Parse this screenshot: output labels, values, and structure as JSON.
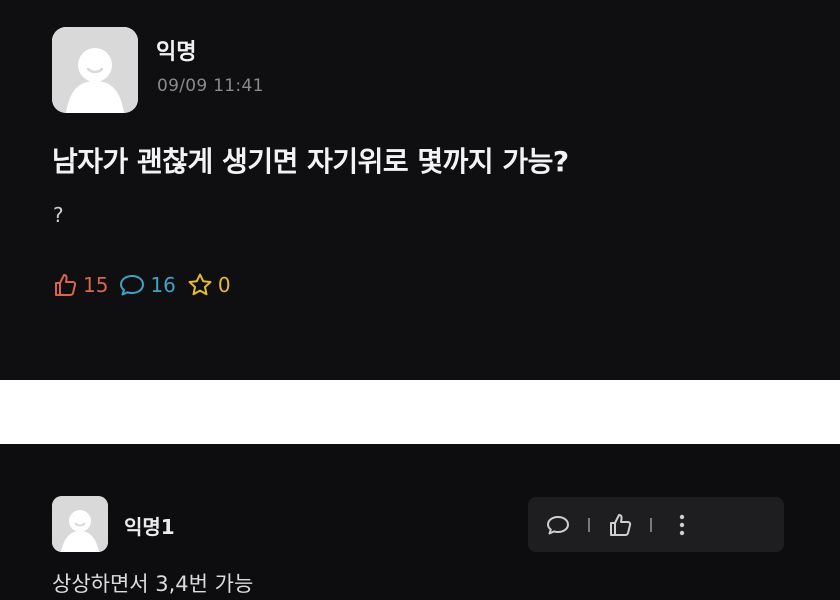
{
  "post": {
    "author": "익명",
    "time": "09/09 11:41",
    "title": "남자가 괜찮게 생기면 자기위로 몇까지 가능?",
    "body": "?",
    "stats": {
      "likes": "15",
      "comments": "16",
      "scraps": "0"
    },
    "icons": {
      "like": "thumbs-up-icon",
      "comment": "speech-bubble-icon",
      "scrap": "star-icon"
    },
    "colors": {
      "like": "#d9654b",
      "comment": "#3fa3c4",
      "scrap": "#e3bc2f"
    }
  },
  "comment": {
    "author": "익명1",
    "text": "상상하면서 3,4번 가능",
    "actions": [
      "reply-bubble-icon",
      "thumbs-up-icon",
      "more-vertical-icon"
    ]
  }
}
